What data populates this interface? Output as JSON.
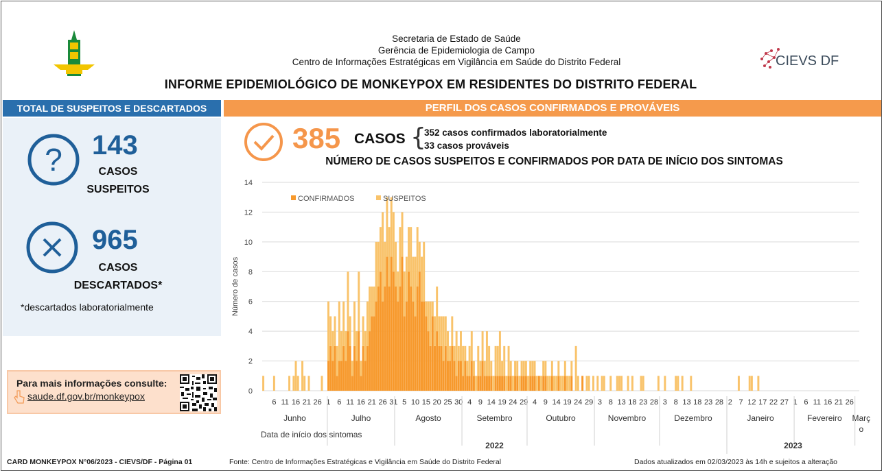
{
  "header": {
    "line1": "Secretaria de Estado de Saúde",
    "line2": "Gerência de Epidemiologia de Campo",
    "line3": "Centro de Informações Estratégicas em Vigilância em Saúde do Distrito Federal",
    "title": "INFORME EPIDEMIOLÓGICO DE MONKEYPOX EM RESIDENTES DO DISTRITO FEDERAL",
    "cievs_label": "CIEVS DF"
  },
  "left": {
    "bar_title": "TOTAL DE SUSPEITOS E DESCARTADOS",
    "suspected_value": "143",
    "suspected_line1": "CASOS",
    "suspected_line2": "SUSPEITOS",
    "discarded_value": "965",
    "discarded_line1": "CASOS",
    "discarded_line2": "DESCARTADOS*",
    "note": "*descartados laboratorialmente",
    "info_title": "Para mais informações consulte:",
    "info_link": "saude.df.gov.br/monkeypox"
  },
  "right": {
    "bar_title": "PERFIL DOS CASOS CONFIRMADOS E PROVÁVEIS",
    "total_value": "385",
    "total_label": "CASOS",
    "detail1": "352 casos confirmados laboratorialmente",
    "detail2": "33 casos prováveis"
  },
  "footer": {
    "left": "CARD MONKEYPOX N°06/2023 - CIEVS/DF - Página 01",
    "middle": "Fonte: Centro de Informações Estratégicas e Vigilância em Saúde do Distrito Federal",
    "right": "Dados atualizados em 02/03/2023 às 14h e sujeitos a alteração"
  },
  "colors": {
    "blue": "#1f5f99",
    "orange_bar": "#f59a4c",
    "confirmados": "#f7992c",
    "suspeitos": "#f9c36b"
  },
  "chart_data": {
    "type": "bar",
    "title": "NÚMERO DE CASOS SUSPEITOS E CONFIRMADOS POR DATA DE INÍCIO DOS SINTOMAS",
    "ylabel": "Número de casos",
    "xlabel": "Data de início  dos sintomas",
    "ylim": [
      0,
      14
    ],
    "yticks": [
      0,
      2,
      4,
      6,
      8,
      10,
      12,
      14
    ],
    "stacked": true,
    "legend": [
      "CONFIRMADOS",
      "SUSPEITOS"
    ],
    "months": [
      {
        "name": "Junho",
        "year": "2022",
        "start_day": 1,
        "days": 30,
        "ticks": [
          "6",
          "11",
          "16",
          "21",
          "26"
        ]
      },
      {
        "name": "Julho",
        "year": "2022",
        "start_day": 1,
        "days": 31,
        "ticks": [
          "1",
          "6",
          "11",
          "16",
          "21",
          "26",
          "31"
        ]
      },
      {
        "name": "Agosto",
        "year": "2022",
        "start_day": 1,
        "days": 31,
        "ticks": [
          "5",
          "10",
          "15",
          "20",
          "25",
          "30"
        ]
      },
      {
        "name": "Setembro",
        "year": "2022",
        "start_day": 1,
        "days": 30,
        "ticks": [
          "4",
          "9",
          "14",
          "19",
          "24",
          "29"
        ]
      },
      {
        "name": "Outubro",
        "year": "2022",
        "start_day": 1,
        "days": 31,
        "ticks": [
          "4",
          "9",
          "14",
          "19",
          "24",
          "29"
        ]
      },
      {
        "name": "Novembro",
        "year": "2022",
        "start_day": 1,
        "days": 30,
        "ticks": [
          "3",
          "8",
          "13",
          "18",
          "23",
          "28"
        ]
      },
      {
        "name": "Dezembro",
        "year": "2022",
        "start_day": 1,
        "days": 31,
        "ticks": [
          "3",
          "8",
          "13",
          "18",
          "23",
          "28"
        ]
      },
      {
        "name": "Janeiro",
        "year": "2023",
        "start_day": 1,
        "days": 31,
        "ticks": [
          "2",
          "7",
          "12",
          "17",
          "22",
          "27"
        ]
      },
      {
        "name": "Fevereiro",
        "year": "2023",
        "start_day": 1,
        "days": 28,
        "ticks": [
          "1",
          "6",
          "11",
          "16",
          "21",
          "26"
        ]
      },
      {
        "name": "Març\no",
        "year": "2023",
        "start_day": 1,
        "days": 2,
        "ticks": []
      }
    ],
    "years": [
      "2022",
      "2023"
    ],
    "series": [
      {
        "name": "CONFIRMADOS",
        "values": [
          0,
          0,
          0,
          0,
          0,
          0,
          0,
          0,
          0,
          0,
          0,
          0,
          0,
          0,
          0,
          0,
          0,
          0,
          0,
          0,
          0,
          0,
          0,
          0,
          0,
          0,
          0,
          0,
          0,
          0,
          2,
          3,
          2,
          3,
          1,
          2,
          2,
          3,
          2,
          4,
          3,
          1,
          3,
          2,
          4,
          1,
          3,
          2,
          3,
          4,
          5,
          5,
          6,
          7,
          8,
          6,
          7,
          9,
          7,
          9,
          8,
          7,
          6,
          7,
          9,
          5,
          6,
          8,
          7,
          6,
          5,
          7,
          8,
          6,
          6,
          5,
          4,
          3,
          5,
          3,
          4,
          3,
          3,
          2,
          3,
          2,
          2,
          3,
          2,
          1,
          2,
          2,
          1,
          2,
          1,
          1,
          2,
          1,
          0,
          1,
          1,
          2,
          1,
          1,
          1,
          1,
          0,
          1,
          1,
          1,
          1,
          1,
          0,
          1,
          1,
          0,
          1,
          1,
          0,
          1,
          1,
          1,
          0,
          1,
          1,
          1,
          0,
          1,
          0,
          1,
          1,
          0,
          0,
          1,
          0,
          0,
          1,
          0,
          0,
          1,
          0,
          0,
          1,
          0,
          0,
          0,
          0,
          1,
          0,
          0,
          0,
          0,
          0,
          0,
          0,
          0,
          0,
          0,
          0,
          0,
          0,
          0,
          0,
          0,
          0,
          0,
          0,
          0,
          0,
          0,
          0,
          0,
          0,
          0,
          0,
          0,
          0,
          0,
          0,
          0,
          0,
          0,
          0,
          0,
          0,
          0,
          0,
          0,
          0,
          0,
          0,
          0,
          0,
          0,
          0,
          0,
          0,
          0,
          0,
          0,
          0,
          0,
          0,
          0,
          0,
          0,
          0,
          0,
          0,
          0,
          0,
          0,
          0,
          0,
          0,
          0,
          0,
          0,
          0,
          0,
          0,
          0,
          0,
          0,
          0,
          0,
          0,
          0,
          0,
          0,
          0,
          0,
          0,
          0,
          0,
          0,
          0,
          0,
          0,
          0,
          0,
          0,
          0,
          0,
          0,
          0,
          0,
          0,
          0,
          0,
          0,
          0,
          0,
          0,
          0,
          0,
          0,
          0,
          0,
          0,
          0,
          0,
          0,
          0,
          0,
          0,
          0,
          0,
          0,
          0
        ]
      },
      {
        "name": "SUSPEITOS",
        "values": [
          1,
          0,
          0,
          0,
          0,
          1,
          0,
          0,
          0,
          0,
          0,
          0,
          1,
          0,
          1,
          2,
          1,
          0,
          2,
          1,
          0,
          1,
          0,
          0,
          0,
          0,
          0,
          1,
          0,
          0,
          4,
          2,
          2,
          2,
          2,
          4,
          2,
          3,
          2,
          4,
          2,
          1,
          3,
          2,
          4,
          1,
          2,
          2,
          3,
          3,
          2,
          2,
          4,
          3,
          3,
          6,
          3,
          4,
          4,
          4,
          4,
          3,
          2,
          4,
          3,
          3,
          3,
          3,
          4,
          3,
          4,
          4,
          2,
          3,
          4,
          1,
          2,
          3,
          1,
          2,
          3,
          2,
          2,
          3,
          2,
          2,
          1,
          2,
          1,
          3,
          1,
          2,
          2,
          1,
          1,
          2,
          2,
          1,
          1,
          2,
          1,
          2,
          1,
          3,
          2,
          1,
          1,
          2,
          2,
          3,
          1,
          2,
          1,
          2,
          1,
          1,
          1,
          1,
          1,
          1,
          1,
          1,
          1,
          1,
          1,
          1,
          1,
          0,
          1,
          1,
          1,
          1,
          1,
          1,
          1,
          1,
          1,
          1,
          1,
          1,
          1,
          1,
          1,
          0,
          3,
          1,
          0,
          0,
          0,
          1,
          1,
          0,
          1,
          0,
          1,
          0,
          1,
          1,
          0,
          0,
          1,
          0,
          0,
          1,
          1,
          1,
          0,
          0,
          1,
          0,
          1,
          0,
          0,
          0,
          1,
          1,
          0,
          0,
          0,
          0,
          0,
          0,
          1,
          0,
          0,
          1,
          0,
          0,
          0,
          0,
          1,
          1,
          0,
          1,
          0,
          0,
          0,
          1,
          0,
          0,
          0,
          0,
          0,
          0,
          0,
          0,
          0,
          0,
          0,
          0,
          0,
          0,
          0,
          0,
          0,
          0,
          0,
          0,
          0,
          1,
          0,
          0,
          0,
          0,
          1,
          1,
          0,
          0,
          1,
          0,
          0,
          0,
          0,
          0,
          0,
          0,
          0,
          0,
          0,
          0,
          0,
          0,
          0,
          0,
          0,
          0,
          0,
          0,
          0,
          0,
          0,
          0,
          0,
          0,
          0,
          0,
          0,
          0,
          0,
          0,
          0,
          0,
          0,
          0
        ]
      }
    ]
  }
}
